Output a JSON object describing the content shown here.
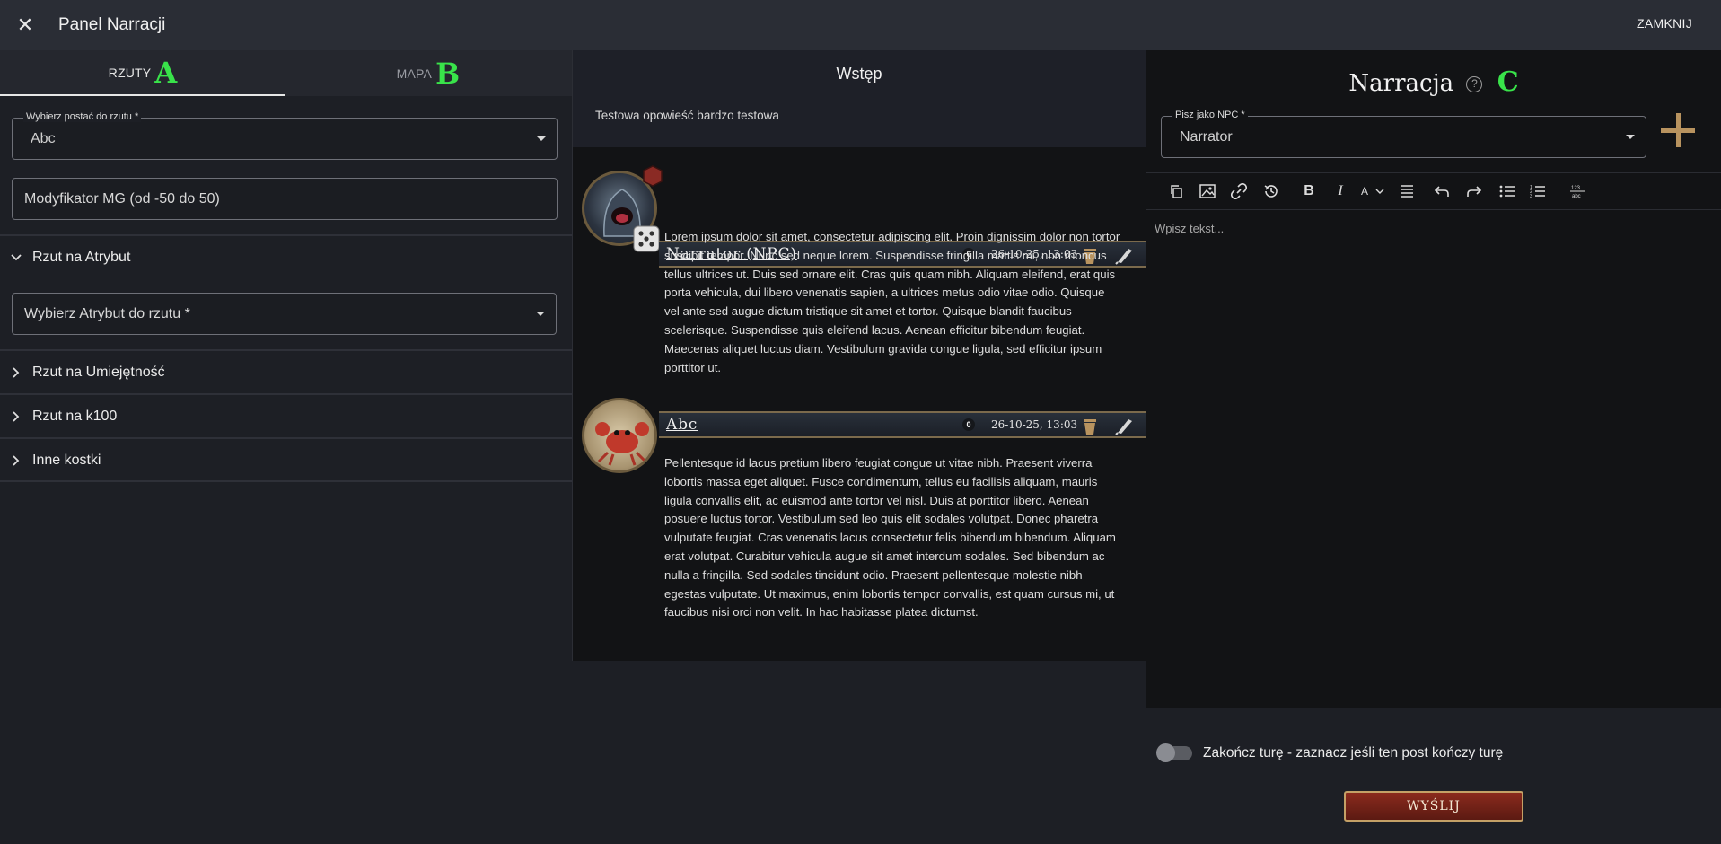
{
  "topbar": {
    "title": "Panel Narracji",
    "close_label": "ZAMKNIJ"
  },
  "tabs": [
    {
      "label": "RZUTY",
      "marker": "A"
    },
    {
      "label": "MAPA",
      "marker": "B"
    }
  ],
  "left": {
    "character": {
      "label": "Wybierz postać do rzutu *",
      "value": "Abc"
    },
    "modifier": {
      "placeholder": "Modyfikator MG (od -50 do 50)"
    },
    "sections": [
      {
        "label": "Rzut na Atrybut",
        "expanded": true
      },
      {
        "label": "Rzut na Umiejętność",
        "expanded": false
      },
      {
        "label": "Rzut na k100",
        "expanded": false
      },
      {
        "label": "Inne kostki",
        "expanded": false
      }
    ],
    "attribute": {
      "placeholder": "Wybierz Atrybut do rzutu *"
    }
  },
  "story": {
    "title": "Wstęp",
    "description": "Testowa opowieść bardzo testowa"
  },
  "posts": [
    {
      "author": "Narrator (NPC)",
      "count": "0",
      "date": "26-10-25, 13:03",
      "text": "Lorem ipsum dolor sit amet, consectetur adipiscing elit. Proin dignissim dolor non tortor suscipit tempor. Nunc sed neque lorem. Suspendisse fringilla mattis mi, non rhoncus tellus ultrices ut. Duis sed ornare elit. Cras quis quam nibh. Aliquam eleifend, erat quis porta vehicula, dui libero venenatis sapien, a ultrices metus odio vitae odio. Quisque vel ante sed augue dictum tristique sit amet et tortor. Quisque blandit faucibus scelerisque. Suspendisse quis eleifend lacus. Aenean efficitur bibendum feugiat. Maecenas aliquet luctus diam. Vestibulum gravida congue ligula, sed efficitur ipsum porttitor ut."
    },
    {
      "author": "Abc",
      "count": "0",
      "date": "26-10-25, 13:03",
      "text": "Pellentesque id lacus pretium libero feugiat congue ut vitae nibh. Praesent viverra lobortis massa eget aliquet. Fusce condimentum, tellus eu facilisis aliquam, mauris ligula convallis elit, ac euismod ante tortor vel nisl. Duis at porttitor libero. Aenean posuere luctus tortor. Vestibulum sed leo quis elit sodales volutpat. Donec pharetra vulputate feugiat. Cras venenatis lacus consectetur felis bibendum bibendum. Aliquam erat volutpat. Curabitur vehicula augue sit amet interdum sodales. Sed bibendum ac nulla a fringilla. Sed sodales tincidunt odio. Praesent pellentesque molestie nibh egestas vulputate. Ut maximus, enim lobortis tempor convallis, est quam cursus mi, ut faucibus nisi orci non velit. In hac habitasse platea dictumst."
    }
  ],
  "narration": {
    "title": "Narracja",
    "help": "?",
    "marker": "C",
    "npc_label": "Pisz jako NPC *",
    "npc_value": "Narrator",
    "editor_placeholder": "Wpisz tekst...",
    "toolbar_icons": [
      "copy-icon",
      "image-icon",
      "link-icon",
      "history-icon",
      "bold-icon",
      "italic-icon",
      "font-color-icon",
      "align-icon",
      "undo-icon",
      "redo-icon",
      "bullet-list-icon",
      "numbered-list-icon",
      "word-count-icon"
    ]
  },
  "footer": {
    "toggle_label": "Zakończ turę - zaznacz jeśli ten post kończy turę",
    "toggle_on": false,
    "send_label": "WYŚLIJ"
  },
  "colors": {
    "accent_gold": "#b8935f",
    "send_red": "#8a2a1d",
    "marker_green": "#39e34a"
  }
}
